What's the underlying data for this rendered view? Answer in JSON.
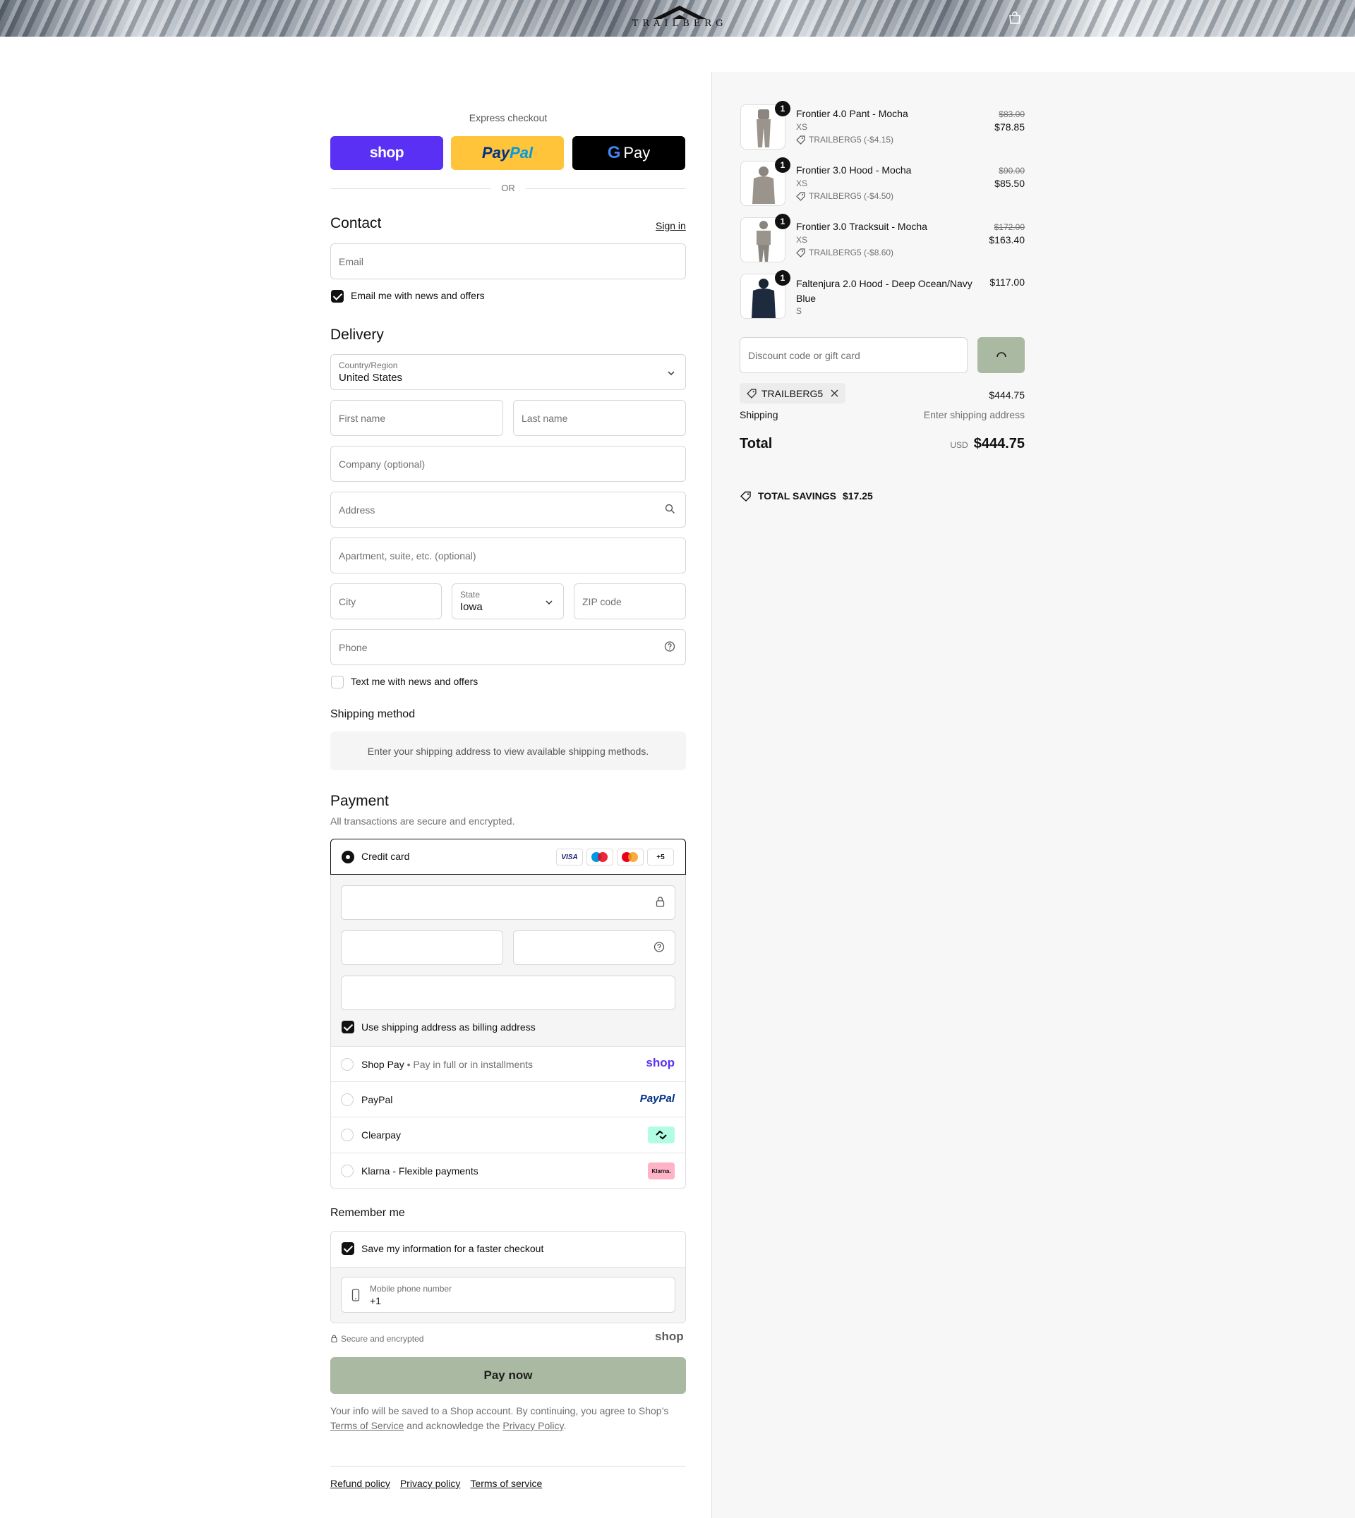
{
  "header": {
    "brand": "TRAILBERG"
  },
  "express": {
    "label": "Express checkout",
    "shop_label": "shop",
    "paypal_pay": "Pay",
    "paypal_pal": "Pal",
    "gpay_label": "Pay",
    "or_label": "OR"
  },
  "contact": {
    "title": "Contact",
    "sign_in": "Sign in",
    "email_placeholder": "Email",
    "news_label": "Email me with news and offers",
    "news_checked": true
  },
  "delivery": {
    "title": "Delivery",
    "country_label": "Country/Region",
    "country_value": "United States",
    "first_name": "First name",
    "last_name": "Last name",
    "company": "Company (optional)",
    "address": "Address",
    "apartment": "Apartment, suite, etc. (optional)",
    "city": "City",
    "state_label": "State",
    "state_value": "Iowa",
    "zip": "ZIP code",
    "phone": "Phone",
    "sms_label": "Text me with news and offers",
    "sms_checked": false
  },
  "shipping_method": {
    "title": "Shipping method",
    "notice": "Enter your shipping address to view available shipping methods."
  },
  "payment": {
    "title": "Payment",
    "subtitle": "All transactions are secure and encrypted.",
    "credit_card_label": "Credit card",
    "card_logos": [
      "VISA",
      "maestro",
      "mastercard",
      "+5"
    ],
    "billing_same_label": "Use shipping address as billing address",
    "billing_same_checked": true,
    "options": [
      {
        "label": "Shop Pay",
        "sub": "Pay in full or in installments",
        "logo": "shop"
      },
      {
        "label": "PayPal",
        "sub": "",
        "logo": "PayPal"
      },
      {
        "label": "Clearpay",
        "sub": "",
        "logo": "clearpay-icon"
      },
      {
        "label": "Klarna - Flexible payments",
        "sub": "",
        "logo": "Klarna."
      }
    ]
  },
  "remember": {
    "title": "Remember me",
    "save_label": "Save my information for a faster checkout",
    "save_checked": true,
    "mobile_label": "Mobile phone number",
    "mobile_value": "+1",
    "secure_label": "Secure and encrypted",
    "shop_logo": "shop"
  },
  "pay_now": "Pay now",
  "legal": {
    "text_before": "Your info will be saved to a Shop account. By continuing, you agree to Shop’s",
    "terms_link": "Terms of Service",
    "text_middle": "and acknowledge the",
    "privacy_link": "Privacy Policy",
    "text_end": "."
  },
  "footer_links": [
    "Refund policy",
    "Privacy policy",
    "Terms of service"
  ],
  "cart": {
    "items": [
      {
        "name": "Frontier 4.0 Pant - Mocha",
        "variant": "XS",
        "discount": "TRAILBERG5 (-$4.15)",
        "original": "$83.00",
        "price": "$78.85",
        "qty": "1"
      },
      {
        "name": "Frontier 3.0 Hood - Mocha",
        "variant": "XS",
        "discount": "TRAILBERG5 (-$4.50)",
        "original": "$90.00",
        "price": "$85.50",
        "qty": "1"
      },
      {
        "name": "Frontier 3.0 Tracksuit - Mocha",
        "variant": "XS",
        "discount": "TRAILBERG5 (-$8.60)",
        "original": "$172.00",
        "price": "$163.40",
        "qty": "1"
      },
      {
        "name_line1": "Faltenjura 2.0 Hood - Deep Ocean/Navy",
        "name_line2": "Blue",
        "variant": "S",
        "price": "$117.00",
        "qty": "1"
      }
    ],
    "discount_placeholder": "Discount code or gift card",
    "applied_code": "TRAILBERG5",
    "subtotal": "$444.75",
    "shipping_label": "Shipping",
    "shipping_value": "Enter shipping address",
    "total_label": "Total",
    "currency": "USD",
    "total_value": "$444.75",
    "savings_label": "TOTAL SAVINGS",
    "savings_value": "$17.25"
  },
  "colors": {
    "shop_purple": "#5a31f4",
    "paypal_yellow": "#ffc439",
    "pay_button": "#aab9a1",
    "apply_button": "#aab9a1"
  }
}
